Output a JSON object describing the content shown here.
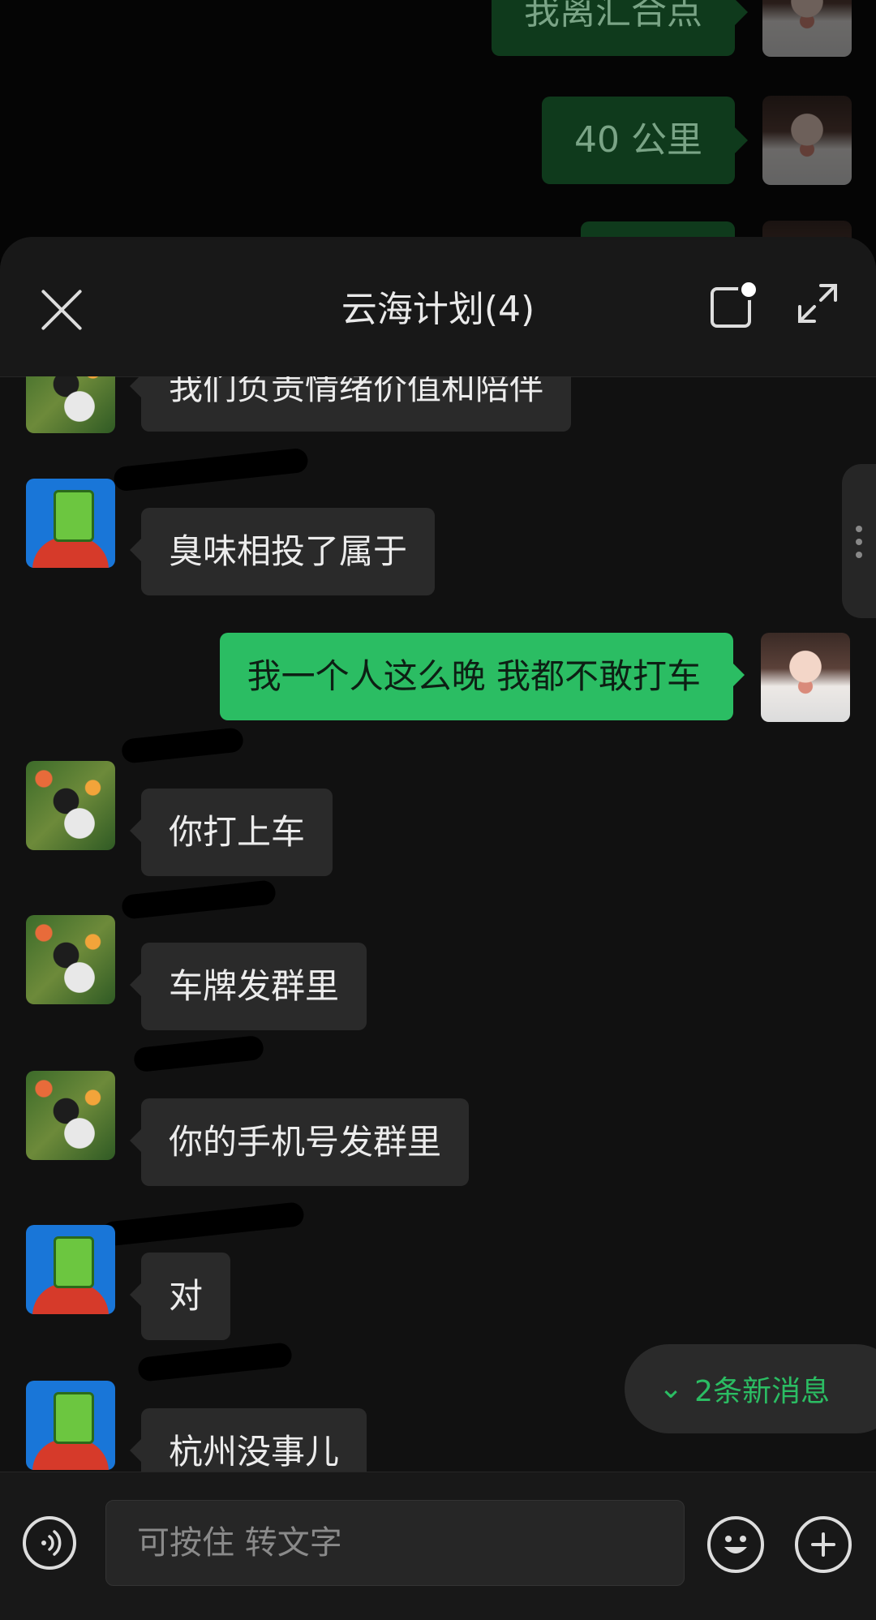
{
  "background_chat": {
    "messages": [
      {
        "text": "我离汇合点"
      },
      {
        "text": "40 公里"
      },
      {
        "text": ""
      }
    ]
  },
  "sheet": {
    "title": "云海计划(4)",
    "icons": {
      "close": "close-icon",
      "note": "square-note-icon",
      "expand": "expand-icon"
    }
  },
  "messages": [
    {
      "side": "in",
      "avatar": "flower",
      "text": "我们负责情绪价值和陪伴"
    },
    {
      "side": "in",
      "avatar": "green-cup",
      "text": "臭味相投了属于"
    },
    {
      "side": "out",
      "avatar": "me",
      "text": "我一个人这么晚 我都不敢打车"
    },
    {
      "side": "in",
      "avatar": "flower",
      "text": "你打上车"
    },
    {
      "side": "in",
      "avatar": "flower",
      "text": "车牌发群里"
    },
    {
      "side": "in",
      "avatar": "flower",
      "text": "你的手机号发群里"
    },
    {
      "side": "in",
      "avatar": "green-cup",
      "text": "对"
    },
    {
      "side": "in",
      "avatar": "green-cup",
      "text": "杭州没事儿"
    }
  ],
  "new_messages_pill": {
    "text": "2条新消息"
  },
  "input_bar": {
    "placeholder": "可按住 转文字"
  },
  "colors": {
    "accent": "#2bbd63",
    "bubble_in": "#2a2a2a",
    "sheet_bg": "#111111"
  }
}
